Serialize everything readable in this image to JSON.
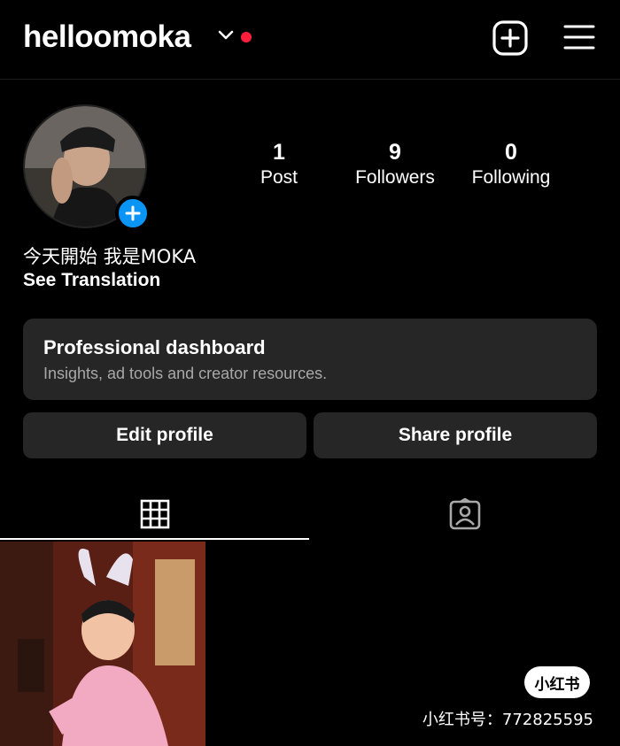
{
  "header": {
    "username": "helloomoka",
    "has_notification_dot": true,
    "notification_color": "#ff1f3d"
  },
  "profile": {
    "stats": [
      {
        "value": "1",
        "label": "Post"
      },
      {
        "value": "9",
        "label": "Followers"
      },
      {
        "value": "0",
        "label": "Following"
      }
    ],
    "bio": "今天開始 我是MOKA",
    "see_translation": "See Translation",
    "add_story_color": "#0a95f6"
  },
  "dashboard": {
    "title": "Professional dashboard",
    "subtitle": "Insights, ad tools and creator resources."
  },
  "actions": {
    "edit_profile": "Edit profile",
    "share_profile": "Share profile"
  },
  "tabs": [
    {
      "name": "posts-grid",
      "icon": "grid-icon",
      "active": true
    },
    {
      "name": "tagged",
      "icon": "tagged-person-icon",
      "active": false
    }
  ],
  "watermark": {
    "badge": "小红书",
    "id_text": "小红书号：772825595"
  }
}
